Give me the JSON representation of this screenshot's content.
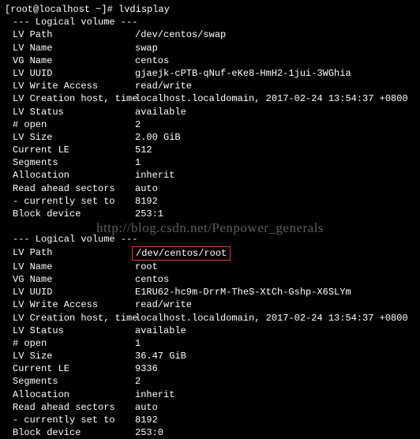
{
  "prompt": "[root@localhost ~]# lvdisplay",
  "watermark": "http://blog.csdn.net/Penpower_generals",
  "volumes": [
    {
      "header": "--- Logical volume ---",
      "rows": [
        {
          "label": "LV Path",
          "value": "/dev/centos/swap",
          "highlight": false
        },
        {
          "label": "LV Name",
          "value": "swap",
          "highlight": false
        },
        {
          "label": "VG Name",
          "value": "centos",
          "highlight": false
        },
        {
          "label": "LV UUID",
          "value": "gjaejk-cPTB-qNuf-eKe8-HmH2-1jui-3WGhia",
          "highlight": false
        },
        {
          "label": "LV Write Access",
          "value": "read/write",
          "highlight": false
        },
        {
          "label": "LV Creation host, time",
          "value": "localhost.localdomain, 2017-02-24 13:54:37 +0800",
          "highlight": false
        },
        {
          "label": "LV Status",
          "value": "available",
          "highlight": false
        },
        {
          "label": "# open",
          "value": "2",
          "highlight": false
        },
        {
          "label": "LV Size",
          "value": "2.00 GiB",
          "highlight": false
        },
        {
          "label": "Current LE",
          "value": "512",
          "highlight": false
        },
        {
          "label": "Segments",
          "value": "1",
          "highlight": false
        },
        {
          "label": "Allocation",
          "value": "inherit",
          "highlight": false
        },
        {
          "label": "Read ahead sectors",
          "value": "auto",
          "highlight": false
        },
        {
          "label": "- currently set to",
          "value": "8192",
          "highlight": false
        },
        {
          "label": "Block device",
          "value": "253:1",
          "highlight": false
        }
      ]
    },
    {
      "header": "--- Logical volume ---",
      "rows": [
        {
          "label": "LV Path",
          "value": "/dev/centos/root",
          "highlight": true
        },
        {
          "label": "LV Name",
          "value": "root",
          "highlight": false
        },
        {
          "label": "VG Name",
          "value": "centos",
          "highlight": false
        },
        {
          "label": "LV UUID",
          "value": "E1RU62-hc9m-DrrM-TheS-XtCh-Gshp-X6SLYm",
          "highlight": false
        },
        {
          "label": "LV Write Access",
          "value": "read/write",
          "highlight": false
        },
        {
          "label": "LV Creation host, time",
          "value": "localhost.localdomain, 2017-02-24 13:54:37 +0800",
          "highlight": false
        },
        {
          "label": "LV Status",
          "value": "available",
          "highlight": false
        },
        {
          "label": "# open",
          "value": "1",
          "highlight": false
        },
        {
          "label": "LV Size",
          "value": "36.47 GiB",
          "highlight": false
        },
        {
          "label": "Current LE",
          "value": "9336",
          "highlight": false
        },
        {
          "label": "Segments",
          "value": "2",
          "highlight": false
        },
        {
          "label": "Allocation",
          "value": "inherit",
          "highlight": false
        },
        {
          "label": "Read ahead sectors",
          "value": "auto",
          "highlight": false
        },
        {
          "label": "- currently set to",
          "value": "8192",
          "highlight": false
        },
        {
          "label": "Block device",
          "value": "253:0",
          "highlight": false
        }
      ]
    }
  ]
}
